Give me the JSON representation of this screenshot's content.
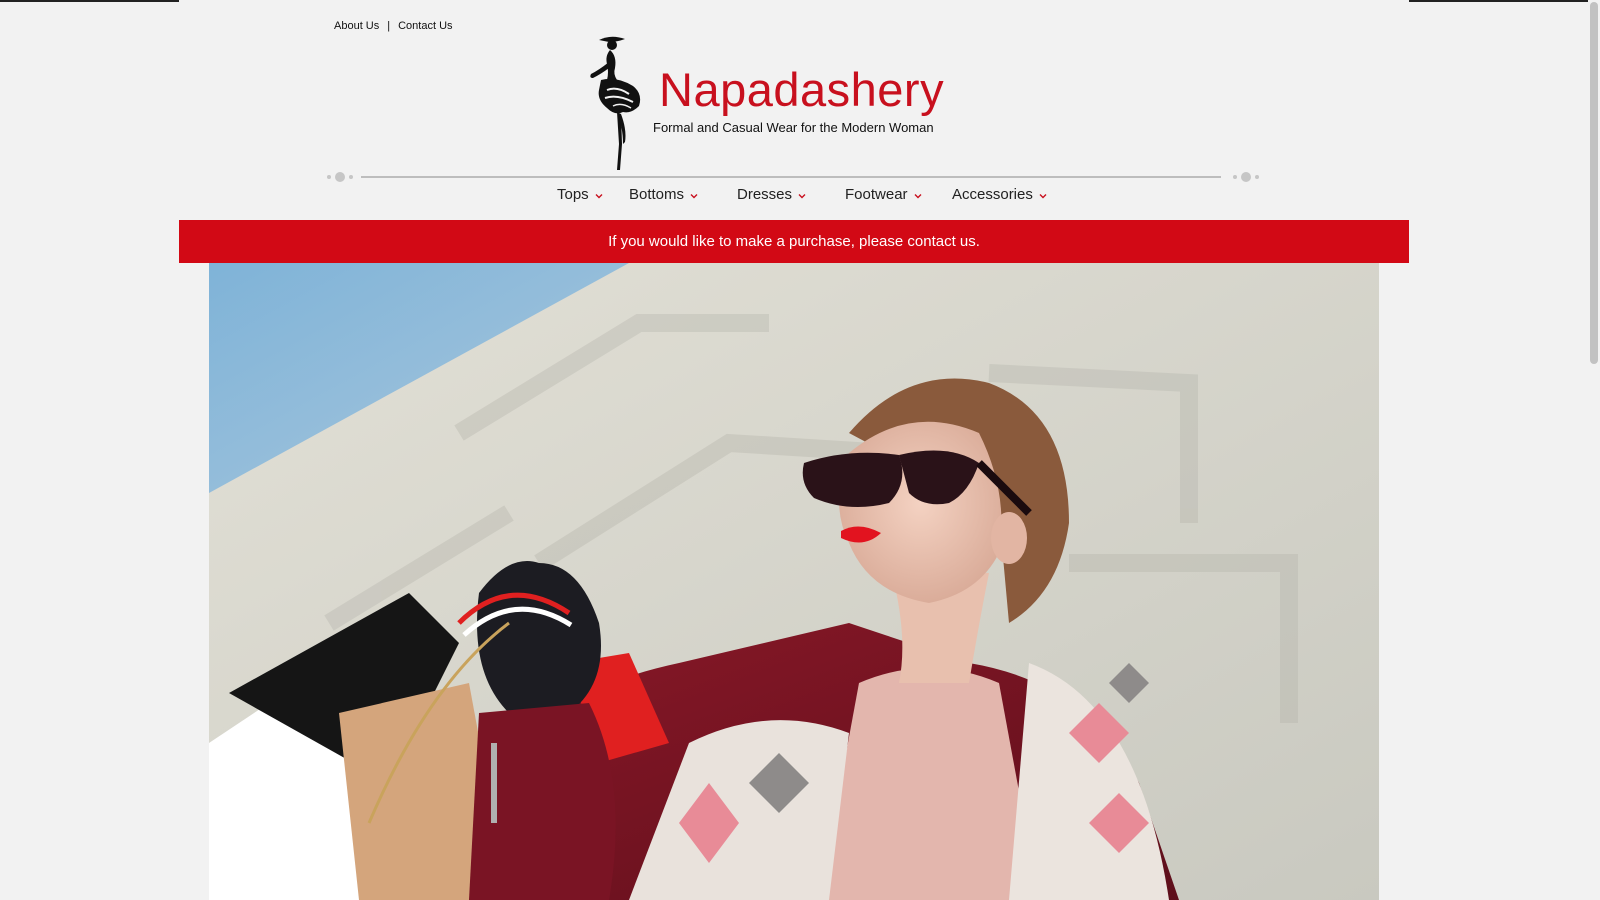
{
  "top_links": {
    "about": "About Us",
    "separator": "|",
    "contact": "Contact Us"
  },
  "brand": {
    "name": "Napadashery",
    "tagline": "Formal and Casual Wear for the Modern Woman",
    "accent_color": "#c8101e"
  },
  "nav": {
    "items": [
      {
        "label": "Tops"
      },
      {
        "label": "Bottoms"
      },
      {
        "label": "Dresses"
      },
      {
        "label": "Footwear"
      },
      {
        "label": "Accessories"
      }
    ],
    "chevron_icon": "chevron-down-icon"
  },
  "banner": {
    "text": "If you would like to make a purchase, please contact us.",
    "background": "#d20915"
  }
}
